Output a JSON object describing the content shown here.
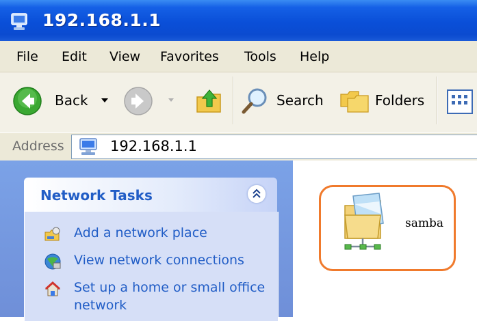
{
  "window": {
    "title": "192.168.1.1",
    "title_icon": "network-computer-icon"
  },
  "menu": {
    "items": [
      "File",
      "Edit",
      "View",
      "Favorites",
      "Tools",
      "Help"
    ]
  },
  "toolbar": {
    "back_label": "Back",
    "search_label": "Search",
    "folders_label": "Folders"
  },
  "address": {
    "label": "Address",
    "value": "192.168.1.1"
  },
  "task_panel": {
    "title": "Network Tasks",
    "tasks": [
      {
        "label": "Add a network place",
        "icon": "add-network-place-icon"
      },
      {
        "label": "View network connections",
        "icon": "network-connections-icon"
      },
      {
        "label": "Set up a home or small office network",
        "icon": "home-network-setup-icon"
      }
    ]
  },
  "content": {
    "items": [
      {
        "label": "samba",
        "icon": "shared-folder-icon"
      }
    ]
  },
  "colors": {
    "titlebar": "#0a4fd8",
    "task_link": "#215dc6",
    "highlight": "#f07a2c"
  }
}
